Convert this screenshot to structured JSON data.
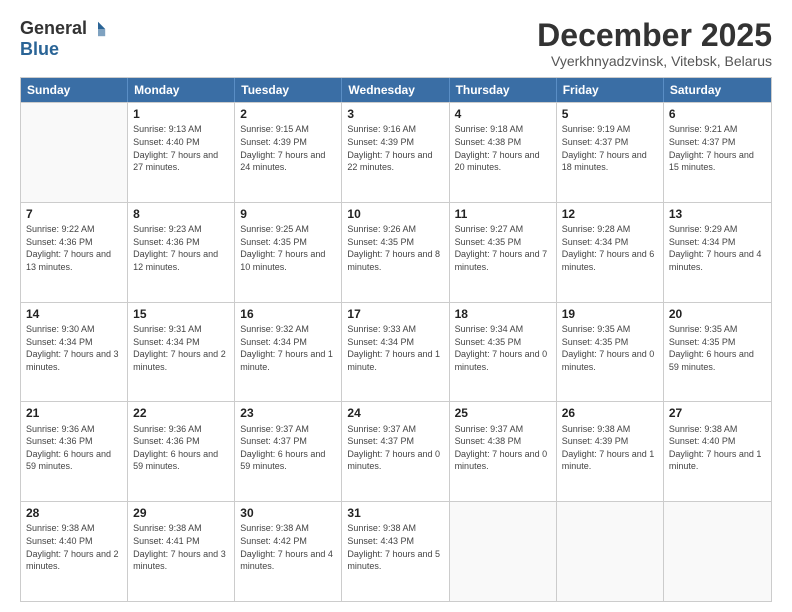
{
  "logo": {
    "general": "General",
    "blue": "Blue"
  },
  "title": "December 2025",
  "location": "Vyerkhnyadzvinsk, Vitebsk, Belarus",
  "days": [
    "Sunday",
    "Monday",
    "Tuesday",
    "Wednesday",
    "Thursday",
    "Friday",
    "Saturday"
  ],
  "rows": [
    [
      {
        "day": "",
        "empty": true
      },
      {
        "day": "1",
        "sunrise": "Sunrise: 9:13 AM",
        "sunset": "Sunset: 4:40 PM",
        "daylight": "Daylight: 7 hours and 27 minutes."
      },
      {
        "day": "2",
        "sunrise": "Sunrise: 9:15 AM",
        "sunset": "Sunset: 4:39 PM",
        "daylight": "Daylight: 7 hours and 24 minutes."
      },
      {
        "day": "3",
        "sunrise": "Sunrise: 9:16 AM",
        "sunset": "Sunset: 4:39 PM",
        "daylight": "Daylight: 7 hours and 22 minutes."
      },
      {
        "day": "4",
        "sunrise": "Sunrise: 9:18 AM",
        "sunset": "Sunset: 4:38 PM",
        "daylight": "Daylight: 7 hours and 20 minutes."
      },
      {
        "day": "5",
        "sunrise": "Sunrise: 9:19 AM",
        "sunset": "Sunset: 4:37 PM",
        "daylight": "Daylight: 7 hours and 18 minutes."
      },
      {
        "day": "6",
        "sunrise": "Sunrise: 9:21 AM",
        "sunset": "Sunset: 4:37 PM",
        "daylight": "Daylight: 7 hours and 15 minutes."
      }
    ],
    [
      {
        "day": "7",
        "sunrise": "Sunrise: 9:22 AM",
        "sunset": "Sunset: 4:36 PM",
        "daylight": "Daylight: 7 hours and 13 minutes."
      },
      {
        "day": "8",
        "sunrise": "Sunrise: 9:23 AM",
        "sunset": "Sunset: 4:36 PM",
        "daylight": "Daylight: 7 hours and 12 minutes."
      },
      {
        "day": "9",
        "sunrise": "Sunrise: 9:25 AM",
        "sunset": "Sunset: 4:35 PM",
        "daylight": "Daylight: 7 hours and 10 minutes."
      },
      {
        "day": "10",
        "sunrise": "Sunrise: 9:26 AM",
        "sunset": "Sunset: 4:35 PM",
        "daylight": "Daylight: 7 hours and 8 minutes."
      },
      {
        "day": "11",
        "sunrise": "Sunrise: 9:27 AM",
        "sunset": "Sunset: 4:35 PM",
        "daylight": "Daylight: 7 hours and 7 minutes."
      },
      {
        "day": "12",
        "sunrise": "Sunrise: 9:28 AM",
        "sunset": "Sunset: 4:34 PM",
        "daylight": "Daylight: 7 hours and 6 minutes."
      },
      {
        "day": "13",
        "sunrise": "Sunrise: 9:29 AM",
        "sunset": "Sunset: 4:34 PM",
        "daylight": "Daylight: 7 hours and 4 minutes."
      }
    ],
    [
      {
        "day": "14",
        "sunrise": "Sunrise: 9:30 AM",
        "sunset": "Sunset: 4:34 PM",
        "daylight": "Daylight: 7 hours and 3 minutes."
      },
      {
        "day": "15",
        "sunrise": "Sunrise: 9:31 AM",
        "sunset": "Sunset: 4:34 PM",
        "daylight": "Daylight: 7 hours and 2 minutes."
      },
      {
        "day": "16",
        "sunrise": "Sunrise: 9:32 AM",
        "sunset": "Sunset: 4:34 PM",
        "daylight": "Daylight: 7 hours and 1 minute."
      },
      {
        "day": "17",
        "sunrise": "Sunrise: 9:33 AM",
        "sunset": "Sunset: 4:34 PM",
        "daylight": "Daylight: 7 hours and 1 minute."
      },
      {
        "day": "18",
        "sunrise": "Sunrise: 9:34 AM",
        "sunset": "Sunset: 4:35 PM",
        "daylight": "Daylight: 7 hours and 0 minutes."
      },
      {
        "day": "19",
        "sunrise": "Sunrise: 9:35 AM",
        "sunset": "Sunset: 4:35 PM",
        "daylight": "Daylight: 7 hours and 0 minutes."
      },
      {
        "day": "20",
        "sunrise": "Sunrise: 9:35 AM",
        "sunset": "Sunset: 4:35 PM",
        "daylight": "Daylight: 6 hours and 59 minutes."
      }
    ],
    [
      {
        "day": "21",
        "sunrise": "Sunrise: 9:36 AM",
        "sunset": "Sunset: 4:36 PM",
        "daylight": "Daylight: 6 hours and 59 minutes."
      },
      {
        "day": "22",
        "sunrise": "Sunrise: 9:36 AM",
        "sunset": "Sunset: 4:36 PM",
        "daylight": "Daylight: 6 hours and 59 minutes."
      },
      {
        "day": "23",
        "sunrise": "Sunrise: 9:37 AM",
        "sunset": "Sunset: 4:37 PM",
        "daylight": "Daylight: 6 hours and 59 minutes."
      },
      {
        "day": "24",
        "sunrise": "Sunrise: 9:37 AM",
        "sunset": "Sunset: 4:37 PM",
        "daylight": "Daylight: 7 hours and 0 minutes."
      },
      {
        "day": "25",
        "sunrise": "Sunrise: 9:37 AM",
        "sunset": "Sunset: 4:38 PM",
        "daylight": "Daylight: 7 hours and 0 minutes."
      },
      {
        "day": "26",
        "sunrise": "Sunrise: 9:38 AM",
        "sunset": "Sunset: 4:39 PM",
        "daylight": "Daylight: 7 hours and 1 minute."
      },
      {
        "day": "27",
        "sunrise": "Sunrise: 9:38 AM",
        "sunset": "Sunset: 4:40 PM",
        "daylight": "Daylight: 7 hours and 1 minute."
      }
    ],
    [
      {
        "day": "28",
        "sunrise": "Sunrise: 9:38 AM",
        "sunset": "Sunset: 4:40 PM",
        "daylight": "Daylight: 7 hours and 2 minutes."
      },
      {
        "day": "29",
        "sunrise": "Sunrise: 9:38 AM",
        "sunset": "Sunset: 4:41 PM",
        "daylight": "Daylight: 7 hours and 3 minutes."
      },
      {
        "day": "30",
        "sunrise": "Sunrise: 9:38 AM",
        "sunset": "Sunset: 4:42 PM",
        "daylight": "Daylight: 7 hours and 4 minutes."
      },
      {
        "day": "31",
        "sunrise": "Sunrise: 9:38 AM",
        "sunset": "Sunset: 4:43 PM",
        "daylight": "Daylight: 7 hours and 5 minutes."
      },
      {
        "day": "",
        "empty": true
      },
      {
        "day": "",
        "empty": true
      },
      {
        "day": "",
        "empty": true
      }
    ]
  ]
}
